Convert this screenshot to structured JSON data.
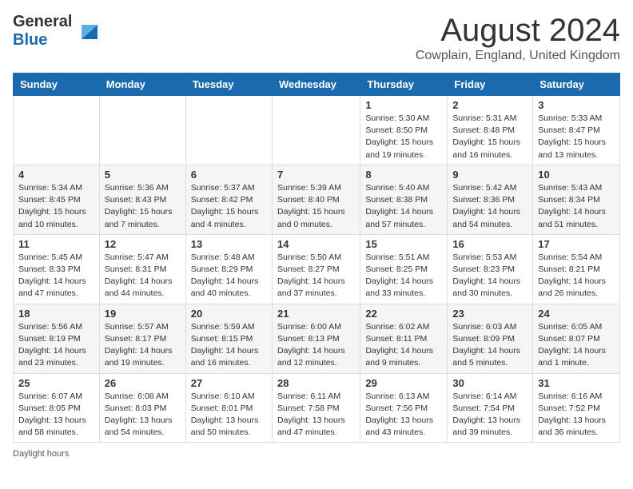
{
  "header": {
    "logo_general": "General",
    "logo_blue": "Blue",
    "month_year": "August 2024",
    "location": "Cowplain, England, United Kingdom"
  },
  "days_of_week": [
    "Sunday",
    "Monday",
    "Tuesday",
    "Wednesday",
    "Thursday",
    "Friday",
    "Saturday"
  ],
  "weeks": [
    [
      {
        "day": "",
        "sunrise": "",
        "sunset": "",
        "daylight": ""
      },
      {
        "day": "",
        "sunrise": "",
        "sunset": "",
        "daylight": ""
      },
      {
        "day": "",
        "sunrise": "",
        "sunset": "",
        "daylight": ""
      },
      {
        "day": "",
        "sunrise": "",
        "sunset": "",
        "daylight": ""
      },
      {
        "day": "1",
        "sunrise": "Sunrise: 5:30 AM",
        "sunset": "Sunset: 8:50 PM",
        "daylight": "Daylight: 15 hours and 19 minutes."
      },
      {
        "day": "2",
        "sunrise": "Sunrise: 5:31 AM",
        "sunset": "Sunset: 8:48 PM",
        "daylight": "Daylight: 15 hours and 16 minutes."
      },
      {
        "day": "3",
        "sunrise": "Sunrise: 5:33 AM",
        "sunset": "Sunset: 8:47 PM",
        "daylight": "Daylight: 15 hours and 13 minutes."
      }
    ],
    [
      {
        "day": "4",
        "sunrise": "Sunrise: 5:34 AM",
        "sunset": "Sunset: 8:45 PM",
        "daylight": "Daylight: 15 hours and 10 minutes."
      },
      {
        "day": "5",
        "sunrise": "Sunrise: 5:36 AM",
        "sunset": "Sunset: 8:43 PM",
        "daylight": "Daylight: 15 hours and 7 minutes."
      },
      {
        "day": "6",
        "sunrise": "Sunrise: 5:37 AM",
        "sunset": "Sunset: 8:42 PM",
        "daylight": "Daylight: 15 hours and 4 minutes."
      },
      {
        "day": "7",
        "sunrise": "Sunrise: 5:39 AM",
        "sunset": "Sunset: 8:40 PM",
        "daylight": "Daylight: 15 hours and 0 minutes."
      },
      {
        "day": "8",
        "sunrise": "Sunrise: 5:40 AM",
        "sunset": "Sunset: 8:38 PM",
        "daylight": "Daylight: 14 hours and 57 minutes."
      },
      {
        "day": "9",
        "sunrise": "Sunrise: 5:42 AM",
        "sunset": "Sunset: 8:36 PM",
        "daylight": "Daylight: 14 hours and 54 minutes."
      },
      {
        "day": "10",
        "sunrise": "Sunrise: 5:43 AM",
        "sunset": "Sunset: 8:34 PM",
        "daylight": "Daylight: 14 hours and 51 minutes."
      }
    ],
    [
      {
        "day": "11",
        "sunrise": "Sunrise: 5:45 AM",
        "sunset": "Sunset: 8:33 PM",
        "daylight": "Daylight: 14 hours and 47 minutes."
      },
      {
        "day": "12",
        "sunrise": "Sunrise: 5:47 AM",
        "sunset": "Sunset: 8:31 PM",
        "daylight": "Daylight: 14 hours and 44 minutes."
      },
      {
        "day": "13",
        "sunrise": "Sunrise: 5:48 AM",
        "sunset": "Sunset: 8:29 PM",
        "daylight": "Daylight: 14 hours and 40 minutes."
      },
      {
        "day": "14",
        "sunrise": "Sunrise: 5:50 AM",
        "sunset": "Sunset: 8:27 PM",
        "daylight": "Daylight: 14 hours and 37 minutes."
      },
      {
        "day": "15",
        "sunrise": "Sunrise: 5:51 AM",
        "sunset": "Sunset: 8:25 PM",
        "daylight": "Daylight: 14 hours and 33 minutes."
      },
      {
        "day": "16",
        "sunrise": "Sunrise: 5:53 AM",
        "sunset": "Sunset: 8:23 PM",
        "daylight": "Daylight: 14 hours and 30 minutes."
      },
      {
        "day": "17",
        "sunrise": "Sunrise: 5:54 AM",
        "sunset": "Sunset: 8:21 PM",
        "daylight": "Daylight: 14 hours and 26 minutes."
      }
    ],
    [
      {
        "day": "18",
        "sunrise": "Sunrise: 5:56 AM",
        "sunset": "Sunset: 8:19 PM",
        "daylight": "Daylight: 14 hours and 23 minutes."
      },
      {
        "day": "19",
        "sunrise": "Sunrise: 5:57 AM",
        "sunset": "Sunset: 8:17 PM",
        "daylight": "Daylight: 14 hours and 19 minutes."
      },
      {
        "day": "20",
        "sunrise": "Sunrise: 5:59 AM",
        "sunset": "Sunset: 8:15 PM",
        "daylight": "Daylight: 14 hours and 16 minutes."
      },
      {
        "day": "21",
        "sunrise": "Sunrise: 6:00 AM",
        "sunset": "Sunset: 8:13 PM",
        "daylight": "Daylight: 14 hours and 12 minutes."
      },
      {
        "day": "22",
        "sunrise": "Sunrise: 6:02 AM",
        "sunset": "Sunset: 8:11 PM",
        "daylight": "Daylight: 14 hours and 9 minutes."
      },
      {
        "day": "23",
        "sunrise": "Sunrise: 6:03 AM",
        "sunset": "Sunset: 8:09 PM",
        "daylight": "Daylight: 14 hours and 5 minutes."
      },
      {
        "day": "24",
        "sunrise": "Sunrise: 6:05 AM",
        "sunset": "Sunset: 8:07 PM",
        "daylight": "Daylight: 14 hours and 1 minute."
      }
    ],
    [
      {
        "day": "25",
        "sunrise": "Sunrise: 6:07 AM",
        "sunset": "Sunset: 8:05 PM",
        "daylight": "Daylight: 13 hours and 58 minutes."
      },
      {
        "day": "26",
        "sunrise": "Sunrise: 6:08 AM",
        "sunset": "Sunset: 8:03 PM",
        "daylight": "Daylight: 13 hours and 54 minutes."
      },
      {
        "day": "27",
        "sunrise": "Sunrise: 6:10 AM",
        "sunset": "Sunset: 8:01 PM",
        "daylight": "Daylight: 13 hours and 50 minutes."
      },
      {
        "day": "28",
        "sunrise": "Sunrise: 6:11 AM",
        "sunset": "Sunset: 7:58 PM",
        "daylight": "Daylight: 13 hours and 47 minutes."
      },
      {
        "day": "29",
        "sunrise": "Sunrise: 6:13 AM",
        "sunset": "Sunset: 7:56 PM",
        "daylight": "Daylight: 13 hours and 43 minutes."
      },
      {
        "day": "30",
        "sunrise": "Sunrise: 6:14 AM",
        "sunset": "Sunset: 7:54 PM",
        "daylight": "Daylight: 13 hours and 39 minutes."
      },
      {
        "day": "31",
        "sunrise": "Sunrise: 6:16 AM",
        "sunset": "Sunset: 7:52 PM",
        "daylight": "Daylight: 13 hours and 36 minutes."
      }
    ]
  ],
  "footer": {
    "daylight_label": "Daylight hours"
  }
}
